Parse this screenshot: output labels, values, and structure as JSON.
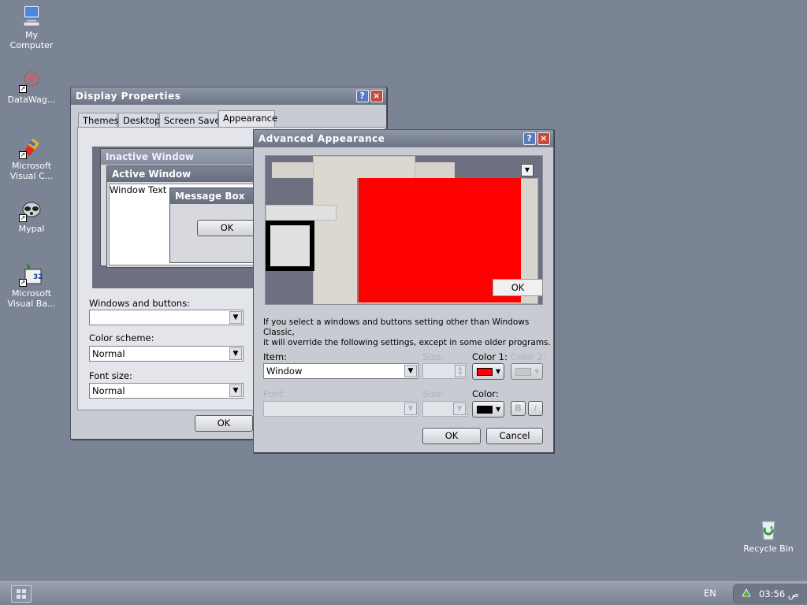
{
  "desktop": {
    "icons": [
      {
        "name": "my-computer",
        "label": "My\nComputer"
      },
      {
        "name": "datawag",
        "label": "DataWag..."
      },
      {
        "name": "ms-visual-c",
        "label": "Microsoft\nVisual C..."
      },
      {
        "name": "mypal",
        "label": "Mypal"
      },
      {
        "name": "ms-visual-basic",
        "label": "Microsoft\nVisual Ba..."
      },
      {
        "name": "recycle-bin",
        "label": "Recycle Bin"
      }
    ]
  },
  "display_properties": {
    "title": "Display Properties",
    "tabs": [
      "Themes",
      "Desktop",
      "Screen Saver",
      "Appearance"
    ],
    "active_tab": "Appearance",
    "preview": {
      "inactive_title": "Inactive Window",
      "active_title": "Active Window",
      "window_text": "Window Text",
      "message_title": "Message Box",
      "message_ok": "OK"
    },
    "windows_buttons_label": "Windows and buttons:",
    "windows_buttons_value": "",
    "color_scheme_label": "Color scheme:",
    "color_scheme_value": "Normal",
    "font_size_label": "Font size:",
    "font_size_value": "Normal",
    "ok_label": "OK"
  },
  "advanced": {
    "title": "Advanced Appearance",
    "preview_ok": "OK",
    "info_line1": "If you select a windows and buttons setting other than Windows Classic,",
    "info_line2": "it will override the following settings, except in some older programs.",
    "item_label": "Item:",
    "item_value": "Window",
    "size_label": "Size:",
    "color1_label": "Color 1:",
    "color2_label": "Color 2:",
    "font_label": "Font:",
    "size2_label": "Size:",
    "color_label": "Color:",
    "bold_label": "B",
    "italic_label": "I",
    "ok_label": "OK",
    "cancel_label": "Cancel",
    "color1_hex": "#ff0000",
    "font_color_hex": "#000000"
  },
  "taskbar": {
    "lang": "EN",
    "clock": "03:56 ص"
  },
  "colors": {
    "desktop": "#7b8494",
    "accent_red": "#ff0000"
  }
}
